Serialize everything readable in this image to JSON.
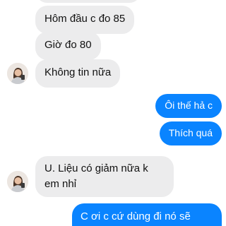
{
  "conversation": {
    "incoming_group_1": [
      "Hôm đầu c đo  85",
      "Giờ đo 80",
      "Không tin nữa"
    ],
    "outgoing_group_1": [
      "Ôi thế hả c",
      "Thích quá"
    ],
    "incoming_group_2": {
      "line1": "U.  Liệu có giảm nữa k",
      "line2": "em nhỉ"
    },
    "outgoing_group_2": [
      "C ơi c cứ dùng đi nó sẽ"
    ]
  },
  "colors": {
    "incoming_bubble": "#ececed",
    "outgoing_bubble": "#0a84ff",
    "incoming_text": "#111111",
    "outgoing_text": "#ffffff"
  },
  "icons": {
    "avatar": "user-avatar-icon"
  }
}
